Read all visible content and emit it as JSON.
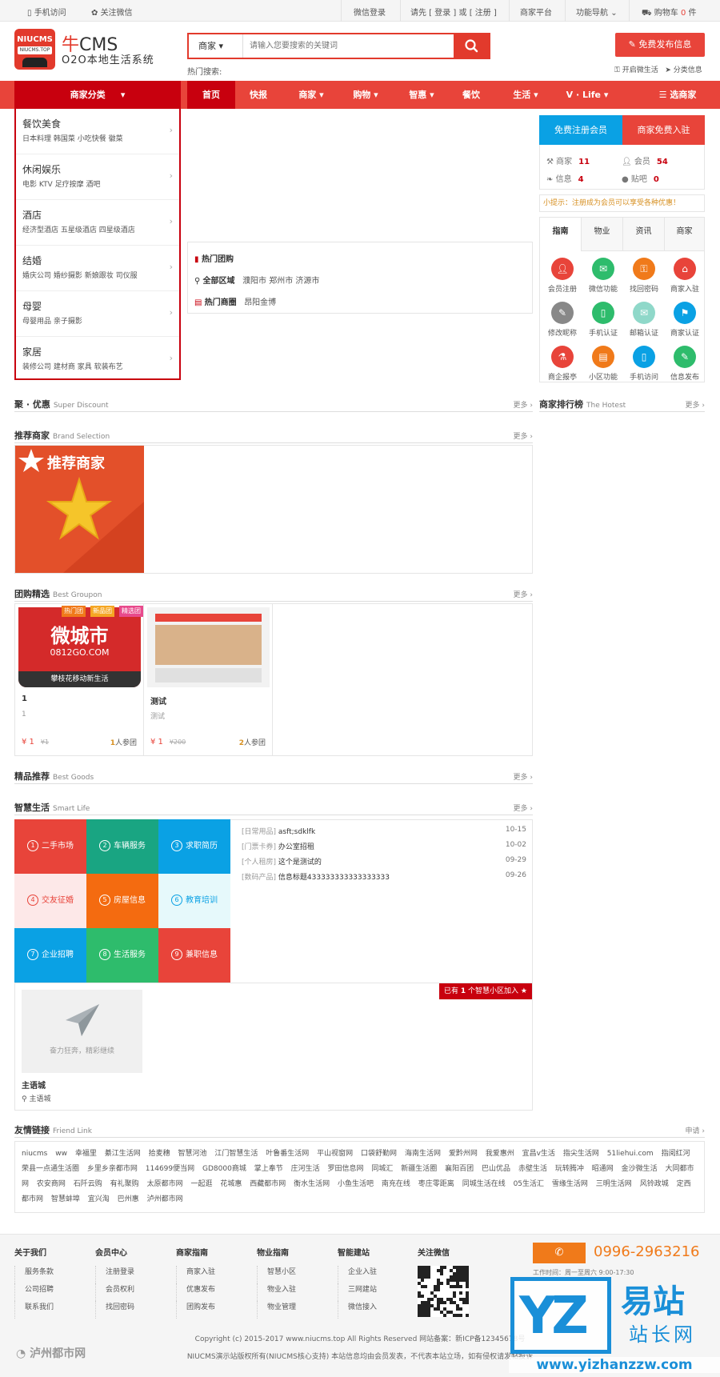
{
  "topbar": {
    "mobile": "手机访问",
    "wechat": "关注微信",
    "wechat_login": "微信登录",
    "login_prompt": "请先 [ 登录 ] 或 [ 注册 ]",
    "merchant_platform": "商家平台",
    "func_nav": "功能导航",
    "cart_label": "购物车",
    "cart_count": "0",
    "cart_unit": "件"
  },
  "header": {
    "logo_top": "NIUCMS",
    "logo_tag": "NIUCMS.TOP",
    "brand_cn": "牛",
    "brand_en": "CMS",
    "subtitle": "O2O本地生活系统",
    "search_type": "商家",
    "search_placeholder": "请输入您要搜索的关键词",
    "hot_search": "热门搜索:",
    "publish": "免费发布信息",
    "open_life": "开启微生活",
    "category_info": "分类信息"
  },
  "nav": {
    "category": "商家分类",
    "items": [
      "首页",
      "快报",
      "商家",
      "购物",
      "智惠",
      "餐饮",
      "生活",
      "V · Life"
    ],
    "select_merchant": "选商家"
  },
  "categories": [
    {
      "title": "餐饮美食",
      "subs": "日本料理  韩国菜  小吃快餐  徽菜"
    },
    {
      "title": "休闲娱乐",
      "subs": "电影  KTV  足疗按摩  酒吧"
    },
    {
      "title": "酒店",
      "subs": "经济型酒店  五星级酒店  四星级酒店"
    },
    {
      "title": "结婚",
      "subs": "婚庆公司  婚纱摄影  新娘跟妆  司仪服"
    },
    {
      "title": "母婴",
      "subs": "母婴用品  亲子摄影"
    },
    {
      "title": "家居",
      "subs": "装修公司  建材商  家具  软装布艺"
    }
  ],
  "groupon_hot": {
    "title": "热门团购",
    "area_label": "全部区域",
    "areas": "濮阳市   郑州市   济源市",
    "circle_label": "热门商圈",
    "circles": "昂阳金博"
  },
  "side": {
    "reg_member": "免费注册会员",
    "reg_merchant": "商家免费入驻",
    "stats": [
      {
        "label": "商家",
        "value": "11"
      },
      {
        "label": "会员",
        "value": "54"
      },
      {
        "label": "信息",
        "value": "4"
      },
      {
        "label": "贴吧",
        "value": "0"
      }
    ],
    "tip": "小提示：注册成为会员可以享受各种优惠！",
    "tabs": [
      "指南",
      "物业",
      "资讯",
      "商家"
    ],
    "guide": [
      {
        "label": "会员注册",
        "color": "#e8443a"
      },
      {
        "label": "微信功能",
        "color": "#2ebc6c"
      },
      {
        "label": "找回密码",
        "color": "#f07a1a"
      },
      {
        "label": "商家入驻",
        "color": "#e8443a"
      },
      {
        "label": "修改昵称",
        "color": "#888888"
      },
      {
        "label": "手机认证",
        "color": "#2ebc6c"
      },
      {
        "label": "邮箱认证",
        "color": "#8fd8c9"
      },
      {
        "label": "商家认证",
        "color": "#0aa1e4"
      },
      {
        "label": "商企报亭",
        "color": "#e8443a"
      },
      {
        "label": "小区功能",
        "color": "#f07a1a"
      },
      {
        "label": "手机访问",
        "color": "#0aa1e4"
      },
      {
        "label": "信息发布",
        "color": "#2ebc6c"
      }
    ],
    "rank_title": "商家排行榜",
    "rank_en": "The Hotest",
    "more": "更多 ›"
  },
  "sections": {
    "discount": {
      "title": "聚 · 优惠",
      "en": "Super Discount",
      "more": "更多 ›"
    },
    "brand": {
      "title": "推荐商家",
      "en": "Brand Selection",
      "more": "更多 ›",
      "img_text": "推荐商家"
    },
    "groupon": {
      "title": "团购精选",
      "en": "Best Groupon",
      "more": "更多 ›"
    },
    "goods": {
      "title": "精品推荐",
      "en": "Best Goods",
      "more": "更多 ›"
    },
    "smart": {
      "title": "智慧生活",
      "en": "Smart Life",
      "more": "更多 ›"
    },
    "friend": {
      "title": "友情链接",
      "en": "Friend Link",
      "more": "申请 ›"
    }
  },
  "groupon_cards": [
    {
      "name": "1",
      "desc": "1",
      "price": "¥ 1",
      "orig": "¥1",
      "joined": "1",
      "join_suffix": "人参团",
      "img_title": "微城市",
      "img_url": "0812GO.COM",
      "img_slogan": "攀枝花移动新生活"
    },
    {
      "name": "测试",
      "desc": "测试",
      "price": "¥ 1",
      "orig": "¥200",
      "joined": "2",
      "join_suffix": "人参团"
    }
  ],
  "groupon_tags": [
    "热门团",
    "新品团",
    "精选团"
  ],
  "smart_grid": [
    {
      "n": "1",
      "label": "二手市场",
      "color": "#e8443a",
      "fg": "#ffffff"
    },
    {
      "n": "2",
      "label": "车辆服务",
      "color": "#19a582",
      "fg": "#ffffff"
    },
    {
      "n": "3",
      "label": "求职简历",
      "color": "#0aa1e4",
      "fg": "#ffffff"
    },
    {
      "n": "4",
      "label": "交友征婚",
      "color": "#fde8e8",
      "fg": "#e8443a"
    },
    {
      "n": "5",
      "label": "房屋信息",
      "color": "#f46b10",
      "fg": "#ffffff"
    },
    {
      "n": "6",
      "label": "教育培训",
      "color": "#e6f9fb",
      "fg": "#0aa1e4"
    },
    {
      "n": "7",
      "label": "企业招聘",
      "color": "#0aa1e4",
      "fg": "#ffffff"
    },
    {
      "n": "8",
      "label": "生活服务",
      "color": "#2ebc6c",
      "fg": "#ffffff"
    },
    {
      "n": "9",
      "label": "兼职信息",
      "color": "#e8443a",
      "fg": "#ffffff"
    }
  ],
  "smart_list": [
    {
      "cat": "[日常用品]",
      "title": "asft;sdklfk",
      "date": "10-15"
    },
    {
      "cat": "[门票卡券]",
      "title": "办公室招租",
      "date": "10-02"
    },
    {
      "cat": "[个人租房]",
      "title": "这个是测试的",
      "date": "09-29"
    },
    {
      "cat": "[数码产品]",
      "title": "信息标题433333333333333333",
      "date": "09-26"
    }
  ],
  "community": {
    "joined_prefix": "已有",
    "joined_count": "1",
    "joined_suffix": "个智慧小区加入",
    "placeholder": "奋力狂奔，精彩继续",
    "name": "主语城",
    "location": "主语城"
  },
  "friend_links": [
    "niucms",
    "ww",
    "幸福里",
    "綦江生活网",
    "拾麦穗",
    "智慧河池",
    "江门智慧生活",
    "叶鲁番生活网",
    "平山视窗网",
    "口袋舒勤网",
    "海南生活网",
    "爱黔州网",
    "我爱惠州",
    "宜昌v生活",
    "指尖生活网",
    "51liehui.com",
    "指阅红河",
    "荣县一点通生活圈",
    "乡里乡亲都市网",
    "114699便当网",
    "GD8000商城",
    "掌上奉节",
    "庄河生活",
    "罗田信息网",
    "同城汇",
    "新疆生活圈",
    "襄阳百团",
    "巴山优品",
    "赤壁生活",
    "玩转腾冲",
    "昭通网",
    "金沙微生活",
    "大同都市网",
    "农安商网",
    "石阡云购",
    "有礼聚购",
    "太原都市网",
    "一起逛",
    "花城惠",
    "西藏都市网",
    "衡水生活网",
    "小鱼生活吧",
    "南充在线",
    "枣庄零距离",
    "同城生活在线",
    "05生活汇",
    "雪缘生活网",
    "三明生活网",
    "风铃政城",
    "定西都市网",
    "智慧蚌埠",
    "宜兴淘",
    "巴州惠",
    "泸州都市网"
  ],
  "footer": {
    "cols": [
      {
        "h": "关于我们",
        "items": [
          "服务条款",
          "公司招聘",
          "联系我们"
        ]
      },
      {
        "h": "会员中心",
        "items": [
          "注册登录",
          "会员权利",
          "找回密码"
        ]
      },
      {
        "h": "商家指南",
        "items": [
          "商家入驻",
          "优惠发布",
          "团购发布"
        ]
      },
      {
        "h": "物业指南",
        "items": [
          "智慧小区",
          "物业入驻",
          "物业管理"
        ]
      },
      {
        "h": "智能建站",
        "items": [
          "企业入驻",
          "三网建站",
          "微信接入"
        ]
      }
    ],
    "follow": "关注微信",
    "phone": "0996-2963216",
    "worktime": "工作时间：周一至周六 9:00-17:30",
    "logo": "泸州都市网",
    "copyright": "Copyright (c) 2015-2017 www.niucms.top All Rights Reserved 网站备案：新ICP备12345678号",
    "disclaimer": "NIUCMS演示站版权所有(NIUCMS核心支持) 本站信息均由会员发表，不代表本站立场，如有侵权请发帖投诉",
    "watermark_big": "易站",
    "watermark_small": "站长网",
    "watermark_url": "www.yizhanzzw.com"
  }
}
